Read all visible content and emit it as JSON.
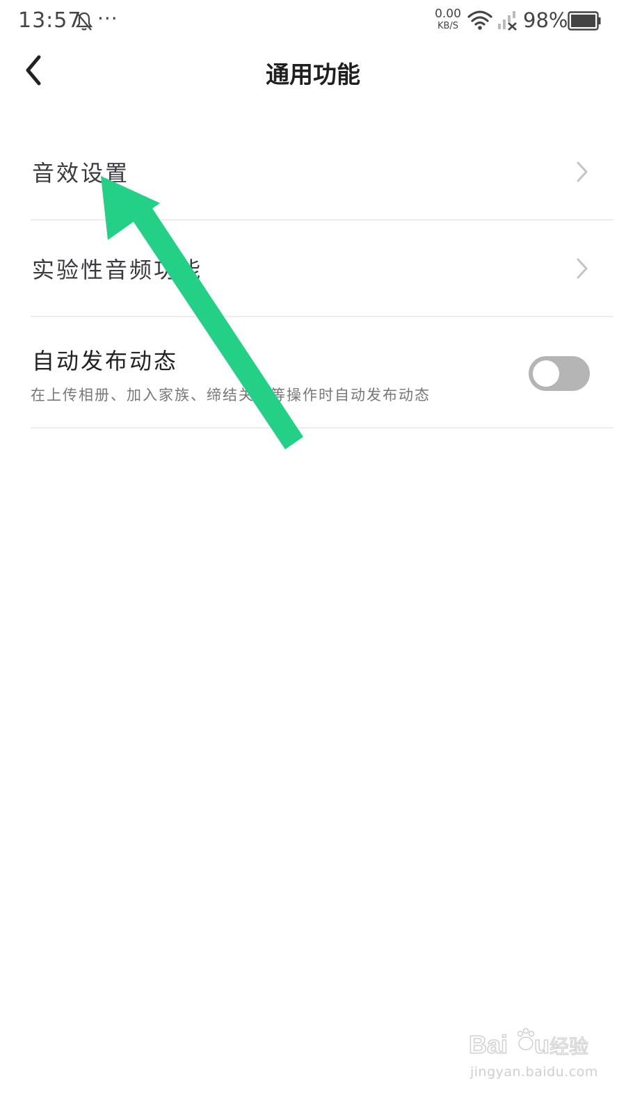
{
  "status_bar": {
    "time": "13:57",
    "dots": "···",
    "net_speed_value": "0.00",
    "net_speed_unit": "KB/S",
    "battery_percent": "98%",
    "icons": [
      "bell-off-icon",
      "more-dots-icon",
      "wifi-icon",
      "signal-no-service-icon",
      "battery-icon"
    ]
  },
  "header": {
    "title": "通用功能",
    "back_icon": "chevron-left-icon"
  },
  "settings": {
    "items": [
      {
        "label": "音效设置",
        "icon": "chevron-right-icon"
      },
      {
        "label": "实验性音频功能",
        "icon": "chevron-right-icon"
      }
    ],
    "auto_post": {
      "title": "自动发布动态",
      "subtitle": "在上传相册、加入家族、缔结关系等操作时自动发布动态",
      "enabled": false
    }
  },
  "annotation": {
    "color": "#24cf86",
    "icon": "arrow-annotation"
  },
  "watermark": {
    "logo_text": "Baidu经验",
    "url": "jingyan.baidu.com"
  }
}
